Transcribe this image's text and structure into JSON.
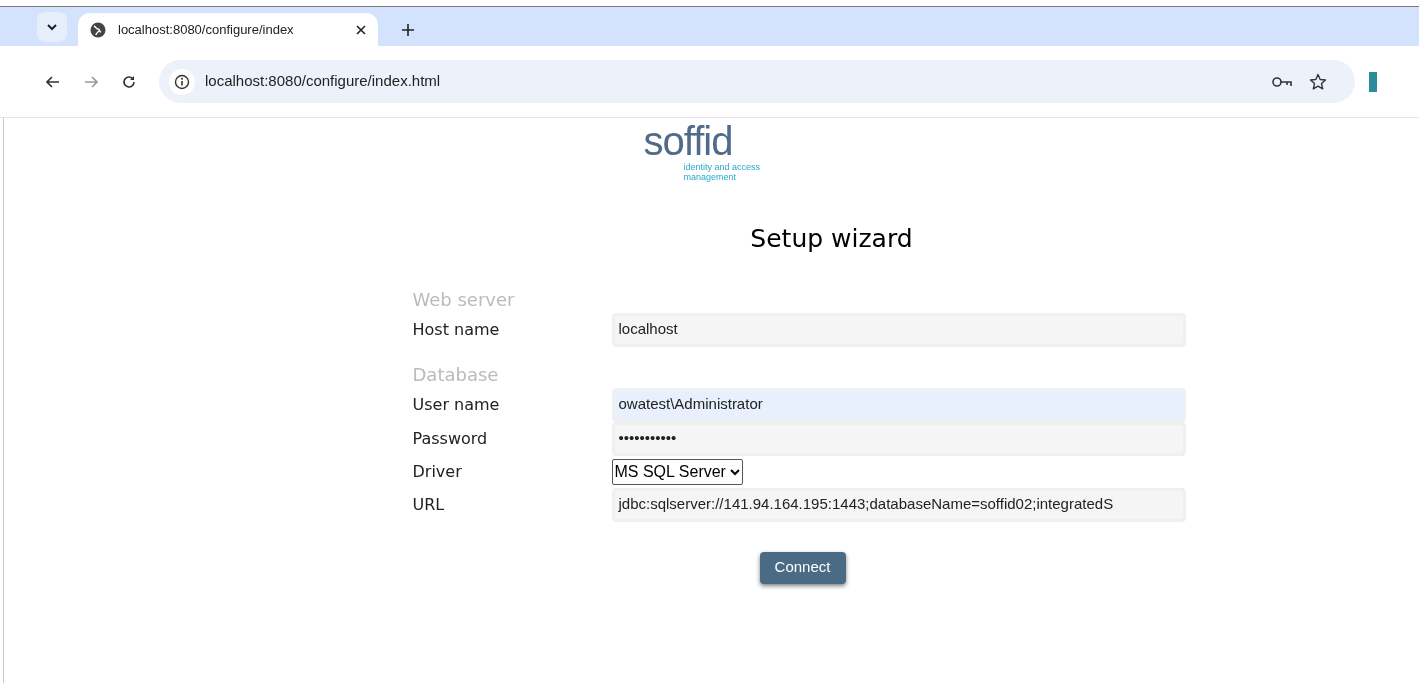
{
  "browser": {
    "tab": {
      "title": "localhost:8080/configure/index",
      "selected": true
    },
    "address": "localhost:8080/configure/index.html"
  },
  "logo": {
    "wordmark": "soffid",
    "tagline": "identity and access management"
  },
  "title": "Setup wizard",
  "sections": [
    {
      "heading": "Web server",
      "fields": [
        {
          "kind": "text",
          "label": "Host name",
          "value": "localhost",
          "focused": false
        }
      ]
    },
    {
      "heading": "Database",
      "fields": [
        {
          "kind": "text",
          "label": "User name",
          "value": "owatest\\Administrator",
          "focused": true
        },
        {
          "kind": "text",
          "label": "Password",
          "value": "•••••••••••",
          "focused": false
        },
        {
          "kind": "select",
          "label": "Driver",
          "value": "MS SQL Server"
        },
        {
          "kind": "text",
          "label": "URL",
          "value": "jdbc:sqlserver://141.94.164.195:1443;databaseName=soffid02;integratedS",
          "focused": false
        }
      ]
    }
  ],
  "button": "Connect"
}
